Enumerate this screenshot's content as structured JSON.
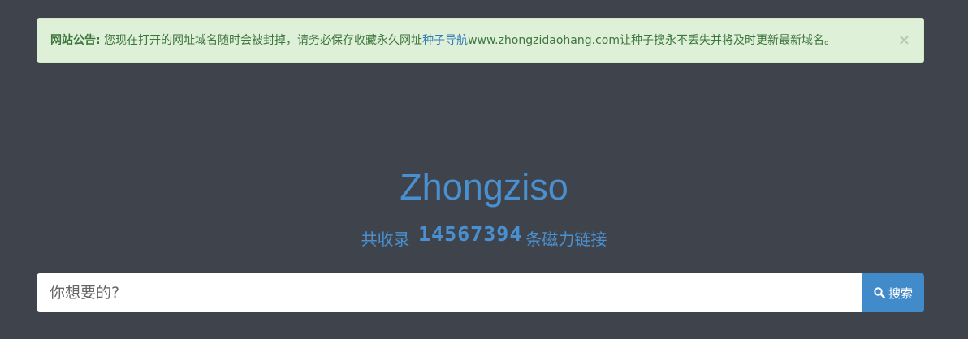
{
  "notice": {
    "label": "网站公告",
    "colon": ":",
    "text_before": " 您现在打开的网址域名随时会被封掉，请务必保存收藏永久网址",
    "link_text": "种子导航",
    "text_after": "www.zhongzidaohang.com让种子搜永不丢失并将及时更新最新域名。",
    "close_label": "×"
  },
  "brand": {
    "title": "Zhongziso"
  },
  "stats": {
    "prefix": "共收录",
    "count": "14567394",
    "suffix": "条磁力链接"
  },
  "search": {
    "placeholder": "你想要的?",
    "value": "",
    "button_label": "搜索",
    "button_icon": "search-icon"
  },
  "colors": {
    "background": "#3f434b",
    "notice_background": "#dff0d8",
    "notice_text": "#3c763d",
    "accent": "#4a90d0",
    "button": "#428bca"
  }
}
